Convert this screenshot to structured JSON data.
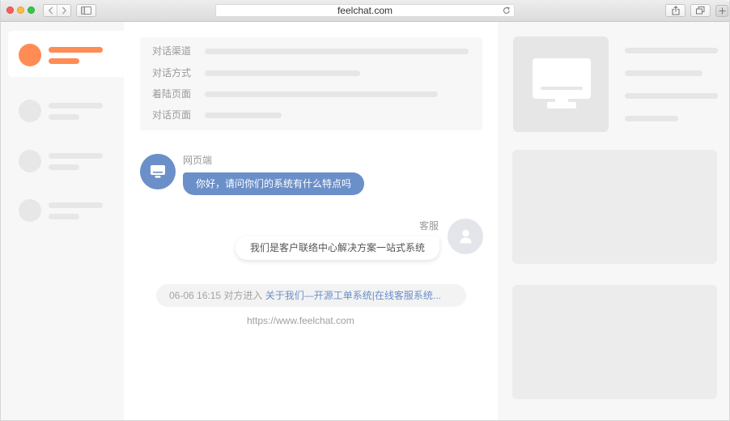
{
  "browser": {
    "address": "feelchat.com",
    "toolbar_icons": [
      "chevron-left-icon",
      "chevron-right-icon",
      "sidebar-icon",
      "reload-icon",
      "share-icon",
      "tabs-icon",
      "plus-icon"
    ]
  },
  "colors": {
    "accent": "#ff8c55",
    "visitor_bubble": "#6b8fc9",
    "link": "#6b8fc9",
    "agent_avatar": "#e3e5ea",
    "close": "#fc605c",
    "minimize": "#fdbc40",
    "maximize": "#34c84a"
  },
  "session_info": {
    "fields": [
      {
        "label": "对话渠道"
      },
      {
        "label": "对话方式"
      },
      {
        "label": "着陆页面"
      },
      {
        "label": "对话页面"
      }
    ]
  },
  "chat": {
    "messages": [
      {
        "sender": "网页端",
        "text": "你好，请问你们的系统有什么特点吗",
        "avatar_icon": "monitor-icon"
      },
      {
        "sender": "客服",
        "text": "我们是客户联络中心解决方案一站式系统",
        "avatar_icon": "person-icon"
      }
    ],
    "notice": {
      "time": "06-06 16:15",
      "event": "对方进入",
      "page_title": "关于我们—开源工单系统|在线客服系统..."
    },
    "page_url": "https://www.feelchat.com"
  },
  "right_panel": {
    "thumbnail_icon": "monitor-icon"
  }
}
